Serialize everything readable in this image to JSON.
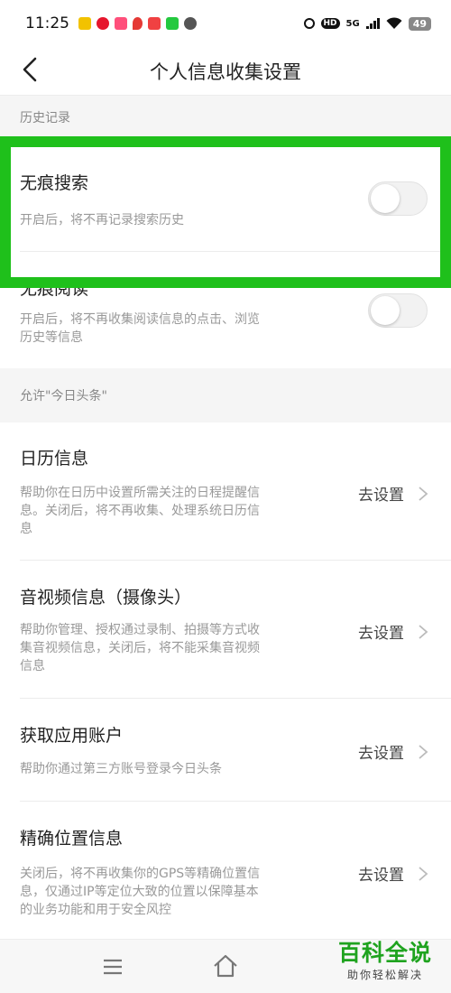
{
  "status": {
    "time": "11:25",
    "network": "5G",
    "hd": "HD",
    "battery": "49",
    "notification_icons": [
      {
        "name": "news-app-icon",
        "color": "#f2c200"
      },
      {
        "name": "weibo-icon",
        "color": "#e6162d"
      },
      {
        "name": "video-app-icon",
        "color": "#ff4f7b"
      },
      {
        "name": "location-app-icon",
        "color": "#e53935"
      },
      {
        "name": "toutiao-app-icon",
        "color": "#f04142"
      },
      {
        "name": "iqiyi-app-icon",
        "color": "#24c93f"
      },
      {
        "name": "message-icon",
        "color": "#555555"
      }
    ]
  },
  "nav": {
    "title": "个人信息收集设置"
  },
  "sections": {
    "history": {
      "header": "历史记录",
      "rows": [
        {
          "title": "无痕搜索",
          "desc": "开启后，将不再记录搜索历史",
          "enabled": false
        },
        {
          "title": "无痕阅读",
          "desc_line1": "开启后，将不再收集阅读信息的点击、浏览",
          "desc_line2": "历史等信息",
          "enabled": false
        }
      ]
    },
    "permissions": {
      "header": "允许\"今日头条\"",
      "action_label": "去设置",
      "rows": [
        {
          "title": "日历信息",
          "desc_line1": "帮助你在日历中设置所需关注的日程提醒信",
          "desc_line2": "息。关闭后，将不再收集、处理系统日历信",
          "desc_line3": "息"
        },
        {
          "title": "音视频信息（摄像头）",
          "desc_line1": "帮助你管理、授权通过录制、拍摄等方式收",
          "desc_line2": "集音视频信息，关闭后，将不能采集音视频",
          "desc_line3": "信息"
        },
        {
          "title": "获取应用账户",
          "desc_line1": "帮助你通过第三方账号登录今日头条"
        },
        {
          "title": "精确位置信息",
          "desc_line1": "关闭后，将不再收集你的GPS等精确位置信",
          "desc_line2": "息，仅通过IP等定位大致的位置以保障基本",
          "desc_line3": "的业务功能和用于安全风控"
        }
      ]
    }
  },
  "watermark": {
    "title": "百科全说",
    "subtitle": "助你轻松解决"
  },
  "colors": {
    "highlight": "#1fc01b",
    "section_bg": "#f5f5f5",
    "watermark_green": "#1fa31f"
  }
}
